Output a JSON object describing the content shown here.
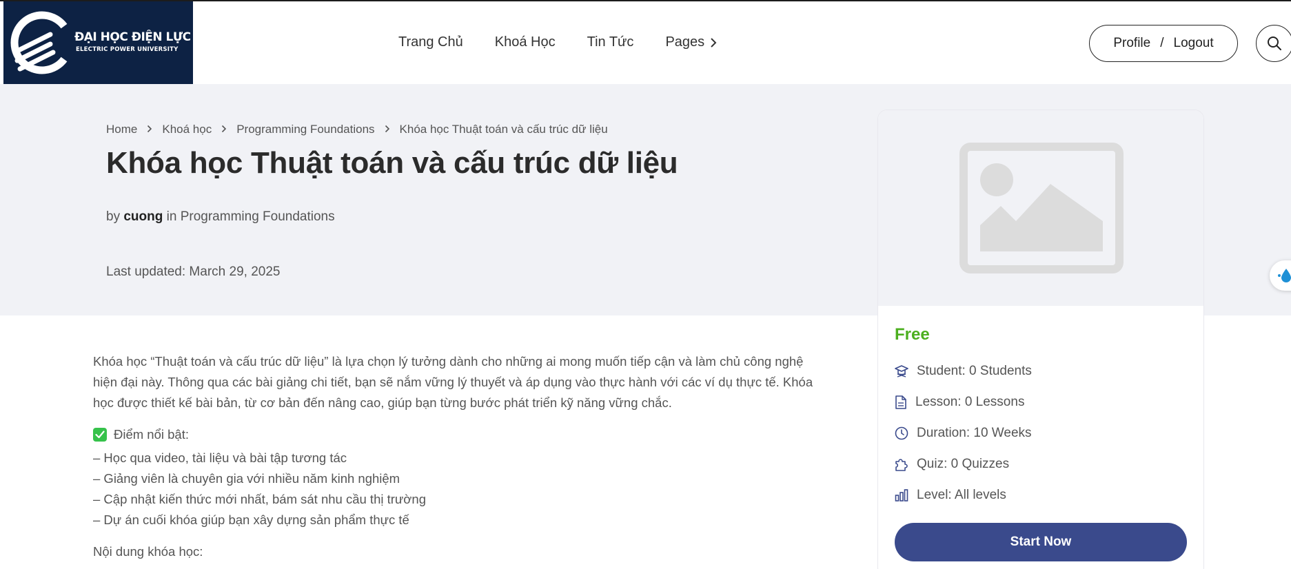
{
  "header": {
    "logo_title": "ĐẠI HỌC ĐIỆN LỰC",
    "logo_subtitle": "ELECTRIC POWER UNIVERSITY",
    "nav": [
      "Trang Chủ",
      "Khoá Học",
      "Tin Tức",
      "Pages"
    ],
    "profile_label": "Profile",
    "auth_separator": "/",
    "logout_label": "Logout"
  },
  "breadcrumb": [
    "Home",
    "Khoá học",
    "Programming Foundations",
    "Khóa học Thuật toán và cấu trúc dữ liệu"
  ],
  "course": {
    "title": "Khóa học Thuật toán và cấu trúc dữ liệu",
    "by_prefix": "by",
    "author": "cuong",
    "in_label": "in",
    "category": "Programming Foundations",
    "last_updated": "Last updated: March 29, 2025"
  },
  "sidebar": {
    "price": "Free",
    "student": "Student: 0 Students",
    "lesson": "Lesson: 0 Lessons",
    "duration": "Duration: 10 Weeks",
    "quiz": "Quiz: 0 Quizzes",
    "level": "Level: All levels",
    "start_button": "Start Now"
  },
  "description": {
    "lines": [
      "Khóa học “Thuật toán và cấu trúc dữ liệu” là lựa chọn lý tưởng dành cho những ai mong muốn tiếp cận và làm chủ công nghệ",
      "hiện đại này. Thông qua các bài giảng chi tiết, bạn sẽ nắm vững lý thuyết và áp dụng vào thực hành với các ví dụ thực tế. Khóa",
      "học được thiết kế bài bản, từ cơ bản đến nâng cao, giúp bạn từng bước phát triển kỹ năng vững chắc."
    ],
    "highlights_title": "Điểm nổi bật:",
    "highlights": [
      "– Học qua video, tài liệu và bài tập tương tác",
      "– Giảng viên là chuyên gia với nhiều năm kinh nghiệm",
      "– Cập nhật kiến thức mới nhất, bám sát nhu cầu thị trường",
      "– Dự án cuối khóa giúp bạn xây dựng sản phẩm thực tế"
    ],
    "content_title": "Nội dung khóa học:"
  },
  "colors": {
    "logo_bg": "#0d2244",
    "hero_bg": "#f1f2f6",
    "price_green": "#4caf1f",
    "button_blue": "#3a4a8c"
  },
  "icons": [
    "logo-icon",
    "chevron-right-icon",
    "search-icon",
    "image-placeholder-icon",
    "graduation-cap-icon",
    "document-icon",
    "clock-icon",
    "puzzle-icon",
    "bar-chart-icon",
    "check-box-icon",
    "water-drop-icon"
  ]
}
